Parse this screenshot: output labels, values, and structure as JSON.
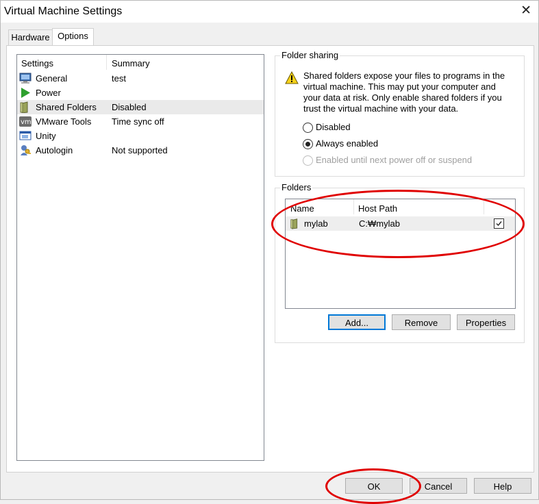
{
  "window": {
    "title": "Virtual Machine Settings",
    "close_glyph": "✕"
  },
  "tabs": [
    {
      "label": "Hardware"
    },
    {
      "label": "Options",
      "active": true
    }
  ],
  "settings_list": {
    "headers": {
      "settings": "Settings",
      "summary": "Summary"
    },
    "items": [
      {
        "label": "General",
        "summary": "test",
        "icon": "monitor-icon"
      },
      {
        "label": "Power",
        "summary": "",
        "icon": "power-play-icon"
      },
      {
        "label": "Shared Folders",
        "summary": "Disabled",
        "icon": "shared-folder-icon",
        "selected": true
      },
      {
        "label": "VMware Tools",
        "summary": "Time sync off",
        "icon": "vmware-tools-icon"
      },
      {
        "label": "Unity",
        "summary": "",
        "icon": "unity-window-icon"
      },
      {
        "label": "Autologin",
        "summary": "Not supported",
        "icon": "autologin-key-icon"
      }
    ]
  },
  "folder_sharing": {
    "title": "Folder sharing",
    "warning_lines": [
      "Shared folders expose your files to programs in the",
      "virtual machine. This may put your computer and",
      "your data at risk. Only enable shared folders if you",
      "trust the virtual machine with your data."
    ],
    "options": [
      {
        "label": "Disabled",
        "selected": false,
        "disabled": false
      },
      {
        "label": "Always enabled",
        "selected": true,
        "disabled": false
      },
      {
        "label": "Enabled until next power off or suspend",
        "selected": false,
        "disabled": true
      }
    ]
  },
  "folders": {
    "title": "Folders",
    "headers": {
      "name": "Name",
      "host_path": "Host Path"
    },
    "rows": [
      {
        "name": "mylab",
        "host_path": "C:₩mylab",
        "enabled": true
      }
    ],
    "buttons": {
      "add": "Add...",
      "remove": "Remove",
      "properties": "Properties"
    }
  },
  "footer": {
    "ok": "OK",
    "cancel": "Cancel",
    "help": "Help"
  },
  "colors": {
    "annotation": "#e00000",
    "selection": "#eaeaea",
    "default_button_border": "#0078d7"
  }
}
